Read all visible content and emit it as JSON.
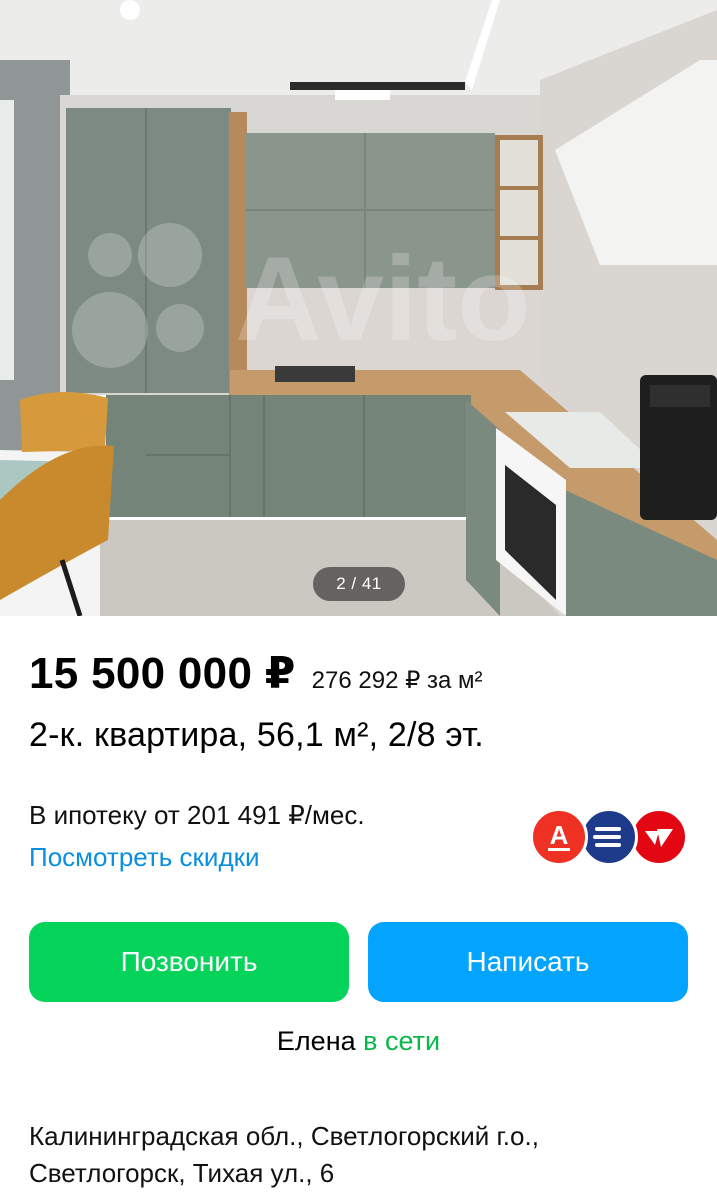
{
  "gallery": {
    "counter": "2 / 41",
    "watermark": "Avito"
  },
  "listing": {
    "price": "15 500 000 ₽",
    "price_per_meter": "276 292 ₽ за м²",
    "title": "2-к. квартира, 56,1 м², 2/8 эт."
  },
  "mortgage": {
    "text": "В ипотеку от 201 491 ₽/мес.",
    "link": "Посмотреть скидки",
    "banks": [
      {
        "icon": "alfa-bank-icon",
        "color": "#ef3124",
        "glyph": "А"
      },
      {
        "icon": "bank-stripes-icon",
        "color": "#1e3a8a"
      },
      {
        "icon": "bank-check-icon",
        "color": "#e30613"
      }
    ]
  },
  "actions": {
    "call": "Позвонить",
    "write": "Написать"
  },
  "seller": {
    "name": "Елена",
    "status": "в сети"
  },
  "address": {
    "line1": "Калининградская обл., Светлогорский г.о.,",
    "line2": "Светлогорск, Тихая ул., 6"
  },
  "colors": {
    "call_green": "#06d35a",
    "write_blue": "#02a4ff",
    "link_blue": "#0a8fe0",
    "online_green": "#08b84a"
  }
}
